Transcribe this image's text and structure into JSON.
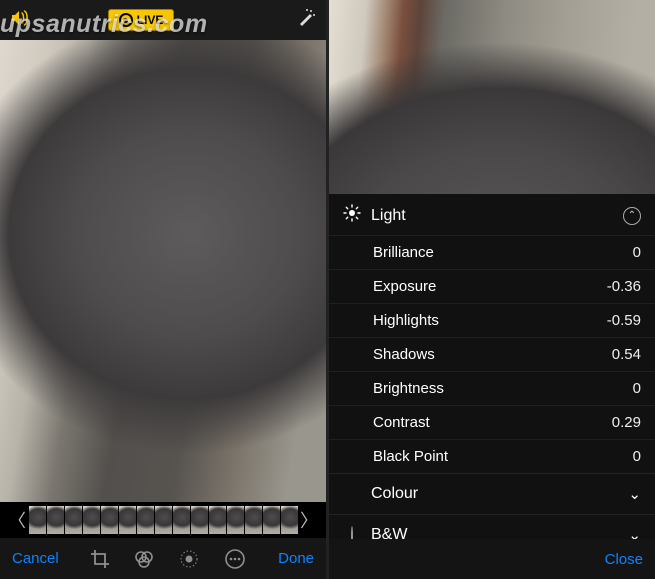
{
  "watermark": "upsanutrics.com",
  "left": {
    "live_label": "LIVE",
    "cancel": "Cancel",
    "done": "Done"
  },
  "right": {
    "close": "Close",
    "light": {
      "title": "Light",
      "brilliance": {
        "label": "Brilliance",
        "value": "0"
      },
      "exposure": {
        "label": "Exposure",
        "value": "-0.36"
      },
      "highlights": {
        "label": "Highlights",
        "value": "-0.59"
      },
      "shadows": {
        "label": "Shadows",
        "value": "0.54"
      },
      "brightness": {
        "label": "Brightness",
        "value": "0"
      },
      "contrast": {
        "label": "Contrast",
        "value": "0.29"
      },
      "blackpoint": {
        "label": "Black Point",
        "value": "0"
      }
    },
    "colour_title": "Colour",
    "bw_title": "B&W"
  }
}
